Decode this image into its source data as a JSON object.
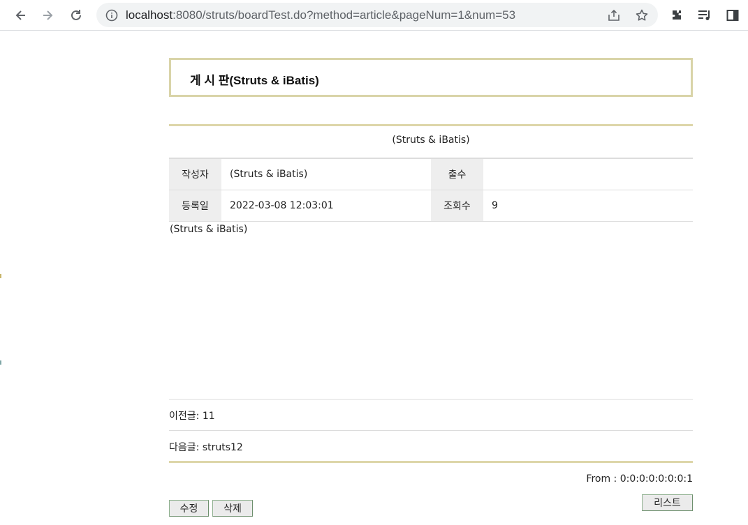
{
  "browser": {
    "url_host": "localhost",
    "url_rest": ":8080/struts/boardTest.do?method=article&pageNum=1&num=53",
    "icons": [
      "back-arrow-icon",
      "forward-arrow-icon",
      "reload-icon",
      "info-icon",
      "share-icon",
      "star-icon",
      "puzzle-icon",
      "media-icon",
      "side-panel-icon"
    ]
  },
  "board": {
    "title": "게 시 판(Struts & iBatis)",
    "subject": "(Struts & iBatis)",
    "author_label": "작성자",
    "author_value": "(Struts & iBatis)",
    "file_label": "출수",
    "file_value": "",
    "date_label": "등록일",
    "date_value": "2022-03-08 12:03:01",
    "views_label": "조회수",
    "views_value": "9",
    "content": "(Struts & iBatis)",
    "prev_label": "이전글: ",
    "prev_value": "11",
    "next_label": "다음글: ",
    "next_value": "struts12",
    "from_text": "From : 0:0:0:0:0:0:0:1",
    "edit_button": "수정",
    "delete_button": "삭제",
    "list_button": "리스트"
  },
  "colors": {
    "accent_rule": "#ddd6a9",
    "label_bg": "#eeeeee",
    "button_border": "#6d8f6d"
  }
}
